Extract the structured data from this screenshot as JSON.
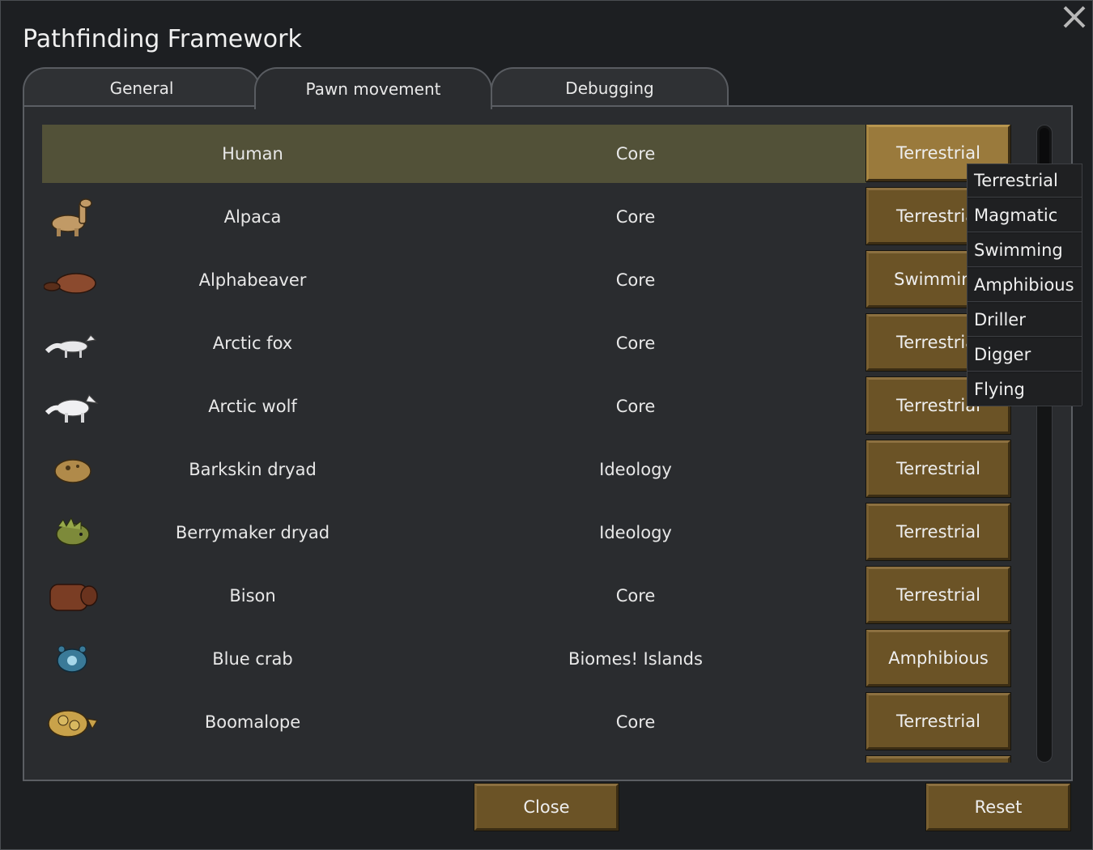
{
  "window": {
    "title": "Pathfinding Framework"
  },
  "tabs": [
    {
      "label": "General"
    },
    {
      "label": "Pawn movement"
    },
    {
      "label": "Debugging"
    }
  ],
  "rows": [
    {
      "name": "Human",
      "source": "Core",
      "movement": "Terrestrial",
      "icon": "none"
    },
    {
      "name": "Alpaca",
      "source": "Core",
      "movement": "Terrestrial",
      "icon": "alpaca-icon"
    },
    {
      "name": "Alphabeaver",
      "source": "Core",
      "movement": "Swimming",
      "icon": "alphabeaver-icon"
    },
    {
      "name": "Arctic fox",
      "source": "Core",
      "movement": "Terrestrial",
      "icon": "arctic-fox-icon"
    },
    {
      "name": "Arctic wolf",
      "source": "Core",
      "movement": "Terrestrial",
      "icon": "arctic-wolf-icon"
    },
    {
      "name": "Barkskin dryad",
      "source": "Ideology",
      "movement": "Terrestrial",
      "icon": "barkskin-dryad-icon"
    },
    {
      "name": "Berrymaker dryad",
      "source": "Ideology",
      "movement": "Terrestrial",
      "icon": "berrymaker-dryad-icon"
    },
    {
      "name": "Bison",
      "source": "Core",
      "movement": "Terrestrial",
      "icon": "bison-icon"
    },
    {
      "name": "Blue crab",
      "source": "Biomes! Islands",
      "movement": "Amphibious",
      "icon": "blue-crab-icon"
    },
    {
      "name": "Boomalope",
      "source": "Core",
      "movement": "Terrestrial",
      "icon": "boomalope-icon"
    }
  ],
  "dropdown": {
    "options": [
      "Terrestrial",
      "Magmatic",
      "Swimming",
      "Amphibious",
      "Driller",
      "Digger",
      "Flying"
    ]
  },
  "buttons": {
    "close": "Close",
    "reset": "Reset"
  },
  "colors": {
    "background": "#1d1f22",
    "panel": "#2a2c2f",
    "button": "#6b5326",
    "button_highlight": "#9a7a3c",
    "row_highlight": "#525138"
  }
}
